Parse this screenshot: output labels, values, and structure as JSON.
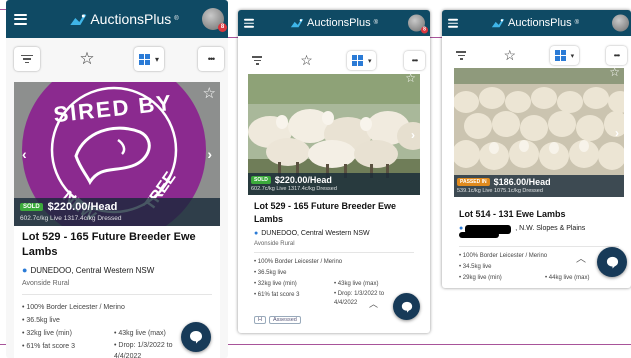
{
  "app": {
    "brand": "AuctionsPlus",
    "trademark": "®",
    "badge_count": "8"
  },
  "icons": {
    "menu": "hamburger-icon",
    "logo": "roo-logo-icon",
    "filter": "filter-icon",
    "watch": "star-icon",
    "view": "grid-view-icon",
    "more": "ellipsis-icon",
    "chat": "chat-bubble-icon",
    "pin": "location-pin-icon"
  },
  "colors": {
    "topbar": "#0f4a64",
    "accent": "#2b7bd6",
    "sold": "#3caa3c",
    "passed_in": "#e08a1e",
    "seal": "#8b2a8f"
  },
  "toolbar": {
    "more_label": "•••"
  },
  "screens": [
    {
      "image_banner": "SIRED BY NEW ... TREE",
      "status": "SOLD",
      "price": "$220.00/Head",
      "price_sub": "602.7c/kg Live 1317.4c/kg Dressed",
      "lot": "Lot 529 - 165 Future Breeder Ewe Lambs",
      "location": "DUNEDOO, Central Western NSW",
      "agent": "Avonside Rural",
      "spec_rows": [
        [
          "• 100% Border Leicester / Merino",
          ""
        ],
        [
          "• 36.5kg live",
          ""
        ],
        [
          "• 32kg live (min)",
          "• 43kg live (max)"
        ],
        [
          "• 61% fat score 3",
          "• Drop: 1/3/2022 to 4/4/2022"
        ]
      ]
    },
    {
      "status": "SOLD",
      "price": "$220.00/Head",
      "price_sub": "602.7c/kg Live 1317.4c/kg Dressed",
      "lot": "Lot 529 - 165 Future Breeder Ewe Lambs",
      "location": "DUNEDOO, Central Western NSW",
      "agent": "Avonside Rural",
      "spec_rows": [
        [
          "• 100% Border Leicester / Merino",
          ""
        ],
        [
          "• 36.5kg live",
          ""
        ],
        [
          "• 32kg live (min)",
          "• 43kg live (max)"
        ],
        [
          "• 61% fat score 3",
          "• Drop: 1/3/2022 to 4/4/2022"
        ]
      ],
      "tags": [
        "H",
        "Assessed"
      ]
    },
    {
      "status": "PASSED IN",
      "price": "$186.00/Head",
      "price_sub": "539.1c/kg Live 1075.1c/kg Dressed",
      "lot": "Lot 514 - 131 Ewe Lambs",
      "location": ", N.W. Slopes & Plains",
      "spec_rows": [
        [
          "• 100% Border Leicester / Merino",
          ""
        ],
        [
          "• 34.5kg live",
          ""
        ],
        [
          "• 29kg live (min)",
          "• 44kg live (max)"
        ]
      ]
    }
  ]
}
